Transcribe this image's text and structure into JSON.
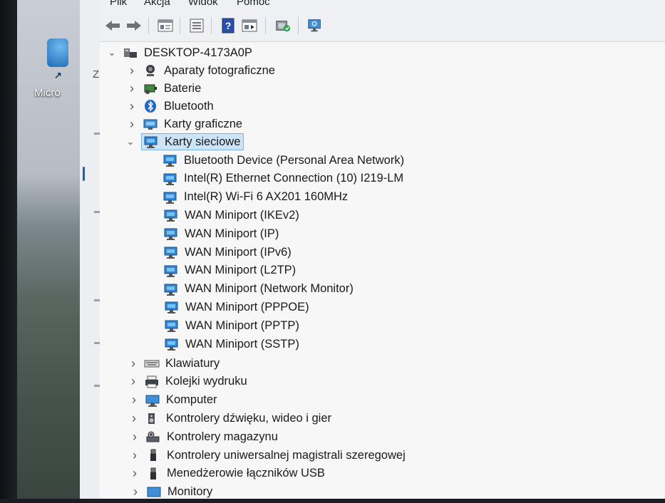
{
  "desktop": {
    "icon_label": "Micro",
    "behind_window_char": "Z"
  },
  "menu": [
    "Plik",
    "Akcja",
    "Widok",
    "Pomoc"
  ],
  "toolbar": {
    "buttons": [
      "back-arrow-icon",
      "forward-arrow-icon",
      "properties-icon",
      "show-hide-icon",
      "help-icon",
      "view-icon",
      "update-driver-icon",
      "monitor-scan-icon"
    ]
  },
  "tree": {
    "root": "DESKTOP-4173A0P",
    "categories_before": [
      {
        "label": "Aparaty fotograficzne",
        "icon": "camera-icon"
      },
      {
        "label": "Baterie",
        "icon": "battery-icon"
      },
      {
        "label": "Bluetooth",
        "icon": "bluetooth-icon"
      },
      {
        "label": "Karty graficzne",
        "icon": "display-adapter-icon"
      }
    ],
    "expanded": {
      "label": "Karty sieciowe",
      "icon": "network-adapter-icon"
    },
    "network_devices": [
      "Bluetooth Device (Personal Area Network)",
      "Intel(R) Ethernet Connection (10) I219-LM",
      "Intel(R) Wi-Fi 6 AX201 160MHz",
      "WAN Miniport (IKEv2)",
      "WAN Miniport (IP)",
      "WAN Miniport (IPv6)",
      "WAN Miniport (L2TP)",
      "WAN Miniport (Network Monitor)",
      "WAN Miniport (PPPOE)",
      "WAN Miniport (PPTP)",
      "WAN Miniport (SSTP)"
    ],
    "categories_after": [
      {
        "label": "Klawiatury",
        "icon": "keyboard-icon"
      },
      {
        "label": "Kolejki wydruku",
        "icon": "printer-icon"
      },
      {
        "label": "Komputer",
        "icon": "computer-icon"
      },
      {
        "label": "Kontrolery dźwięku, wideo i gier",
        "icon": "speaker-icon"
      },
      {
        "label": "Kontrolery magazynu",
        "icon": "storage-controller-icon"
      },
      {
        "label": "Kontrolery uniwersalnej magistrali szeregowej",
        "icon": "usb-icon"
      },
      {
        "label": "Menedżerowie łączników USB",
        "icon": "usb-connector-icon"
      },
      {
        "label": "Monitory",
        "icon": "monitor-icon"
      }
    ]
  },
  "colors": {
    "selection": "#cde4f7",
    "accent": "#1f6fb8"
  }
}
